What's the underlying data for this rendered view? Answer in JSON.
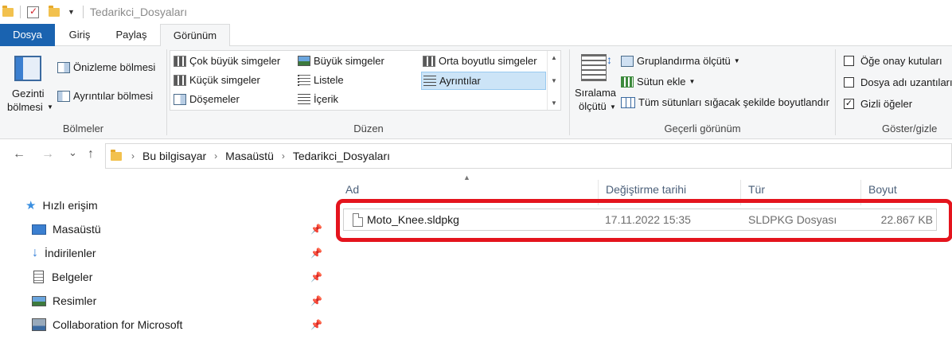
{
  "window": {
    "title": "Tedarikci_Dosyaları"
  },
  "tabs": [
    "Dosya",
    "Giriş",
    "Paylaş",
    "Görünüm"
  ],
  "ribbon": {
    "panes": {
      "nav_pane_line1": "Gezinti",
      "nav_pane_line2": "bölmesi",
      "preview_pane": "Önizleme bölmesi",
      "details_pane": "Ayrıntılar bölmesi",
      "label": "Bölmeler"
    },
    "layout": {
      "extra_large": "Çok büyük simgeler",
      "large": "Büyük simgeler",
      "medium": "Orta boyutlu simgeler",
      "small": "Küçük simgeler",
      "list": "Listele",
      "details": "Ayrıntılar",
      "tiles": "Döşemeler",
      "content": "İçerik",
      "label": "Düzen"
    },
    "current_view": {
      "sort_line1": "Sıralama",
      "sort_line2": "ölçütü",
      "group_by": "Gruplandırma ölçütü",
      "add_columns": "Sütun ekle",
      "fit_columns": "Tüm sütunları sığacak şekilde boyutlandır",
      "label": "Geçerli görünüm"
    },
    "show_hide": {
      "item_checkboxes": "Öğe onay kutuları",
      "item_checkboxes_checked": false,
      "file_extensions": "Dosya adı uzantıları",
      "file_extensions_checked": false,
      "hidden_items": "Gizli öğeler",
      "hidden_items_checked": true,
      "check_mark": "✓",
      "label": "Göster/gizle"
    }
  },
  "address": {
    "crumbs": [
      "Bu bilgisayar",
      "Masaüstü",
      "Tedarikci_Dosyaları"
    ],
    "separator": "›"
  },
  "nav": {
    "back": "←",
    "forward": "→",
    "recent": "⌄",
    "up": "↑"
  },
  "sidebar": {
    "items": [
      {
        "label": "Hızlı erişim",
        "icon": "star-icon"
      },
      {
        "label": "Masaüstü",
        "icon": "desktop-icon",
        "pinned": true
      },
      {
        "label": "İndirilenler",
        "icon": "download-icon",
        "pinned": true
      },
      {
        "label": "Belgeler",
        "icon": "documents-icon",
        "pinned": true
      },
      {
        "label": "Resimler",
        "icon": "pictures-icon",
        "pinned": true
      },
      {
        "label": "Collaboration for Microsoft",
        "icon": "network-icon",
        "pinned": true
      }
    ],
    "pin_glyph": "📌"
  },
  "file_list": {
    "columns": [
      "Ad",
      "Değiştirme tarihi",
      "Tür",
      "Boyut"
    ],
    "sort_indicator": "▲",
    "rows": [
      {
        "name": "Moto_Knee.sldpkg",
        "modified": "17.11.2022 15:35",
        "type": "SLDPKG Dosyası",
        "size": "22.867 KB"
      }
    ]
  },
  "colors": {
    "file_tab": "#1a63b0",
    "highlight": "#e4141d",
    "selection": "#cce4f7"
  }
}
